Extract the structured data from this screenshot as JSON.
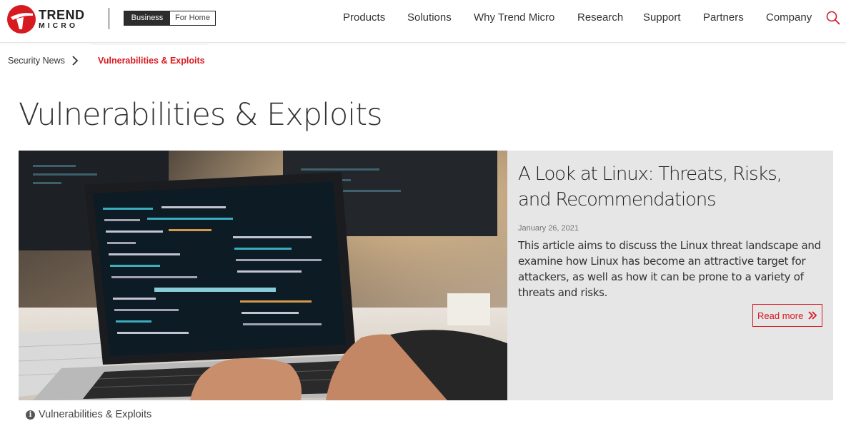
{
  "brand": {
    "word1": "TREND",
    "word2": "MICRO",
    "accent_color": "#d71920"
  },
  "audience_toggle": {
    "business": "Business",
    "home": "For Home"
  },
  "nav": {
    "items": [
      "Products",
      "Solutions",
      "Why Trend Micro",
      "Research",
      "Support",
      "Partners",
      "Company"
    ],
    "search_icon": "search-icon"
  },
  "breadcrumb": {
    "parent": "Security News",
    "current": "Vulnerabilities & Exploits"
  },
  "page": {
    "title": "Vulnerabilities & Exploits"
  },
  "featured": {
    "title": "A Look at Linux: Threats, Risks, and Recommendations",
    "date": "January 26, 2021",
    "description": "This article aims to discuss the Linux threat landscape and examine how Linux has become an attractive target for attackers, as well as how it can be prone to a variety of threats and risks.",
    "cta": "Read more",
    "image_subject": "developer-laptop-code-photo"
  },
  "caption": {
    "icon": "info-icon",
    "text": "Vulnerabilities & Exploits"
  }
}
